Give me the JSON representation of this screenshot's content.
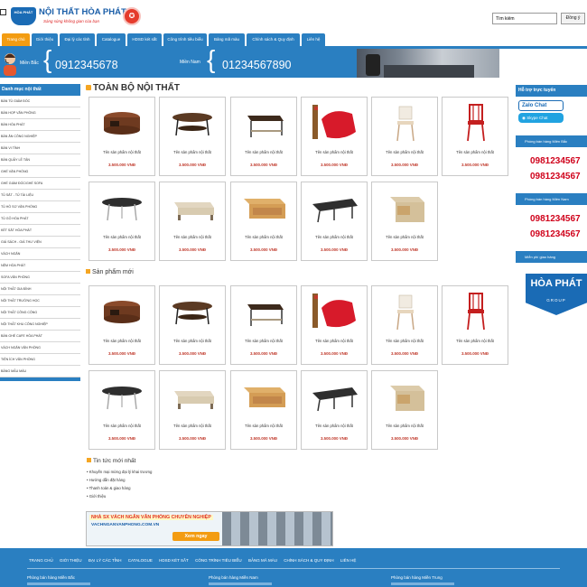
{
  "header": {
    "brand_emblem": "HÒA PHÁT",
    "brand_title": "NỘI THẤT HÒA PHÁT",
    "brand_slogan": "Sáng sủng không gian của bạn",
    "search_placeholder": "Tìm kiếm",
    "search_value": "Tìm kiếm",
    "search_button": "Đồng ý"
  },
  "nav": {
    "items": [
      {
        "label": "Trang chủ",
        "active": true
      },
      {
        "label": "Giới thiệu"
      },
      {
        "label": "Đại lý các tỉnh"
      },
      {
        "label": "Catalogue"
      },
      {
        "label": "HDSD két sắt"
      },
      {
        "label": "Công trình tiêu biểu"
      },
      {
        "label": "Bảng mã màu"
      },
      {
        "label": "Chính sách & Quy định"
      },
      {
        "label": "Liên hệ"
      }
    ]
  },
  "banner": {
    "north_label": "Miền Bắc",
    "north_phone": "0912345678",
    "south_label": "Miền Nam",
    "south_phone": "01234567890"
  },
  "left_sidebar": {
    "title": "Danh mục nội thất",
    "items": [
      "BÀN TỦ GIÁM ĐỐC",
      "BÀN HỌP VĂN PHÒNG",
      "BÀN HÒA PHÁT",
      "BÀN ĂN CÔNG NGHIỆP",
      "BÀN VI TÍNH",
      "BÀN QUẦY LỄ TÂN",
      "GHẾ VĂN PHÒNG",
      "GHẾ GIÁM ĐỐC/GHẾ SOFA",
      "TỦ SẮT - TỦ TÀI LIỆU",
      "TỦ HỒ SƠ VĂN PHÒNG",
      "TỦ GỖ HÒA PHÁT",
      "KÉT SẮT HÒA PHÁT",
      "GIÁ SÁCH - GIÁ THƯ VIỆN",
      "VÁCH NGĂN",
      "NỆM HÒA PHÁT",
      "SOFA VĂN PHÒNG",
      "NỘI THẤT GIA ĐÌNH",
      "NỘI THẤT TRƯỜNG HỌC",
      "NỘI THẤT CÔNG CỘNG",
      "NỘI THẤT KHU CÔNG NGHIỆP",
      "BÀN GHẾ CAFE HÒA PHÁT",
      "VÁCH NGĂN VĂN PHÒNG",
      "TIỆN ÍCH VĂN PHÒNG",
      "BẢNG MẪU MÀU"
    ]
  },
  "main": {
    "section1_title": "TOÀN BỘ NỘI THẤT",
    "section2_title": "Sản phẩm mới",
    "product_name": "Tên sản phẩm nội thất",
    "product_price": "3.500.000 VNĐ"
  },
  "right_sidebar": {
    "support_title": "Hỗ trợ trực tuyến",
    "zalo_label": "Zalo Chat",
    "skype_label": "Skype Chat",
    "north_sales": "Phòng bán hàng Miền Bắc",
    "north_phones": [
      "0981234567",
      "0981234567"
    ],
    "south_sales": "Phòng bán hàng Miền Nam",
    "south_phones": [
      "0981234567",
      "0981234567"
    ],
    "free_shipping": "Miễn phí giao hàng",
    "hp_logo": "HÒA PHÁT",
    "hp_group": "GROUP"
  },
  "news": {
    "title": "Tin tức mới nhất",
    "items": [
      "Khuyến mại mừng đại lý khai trương",
      "Hướng dẫn đặt hàng",
      "Thanh toán & giao hàng",
      "Giới thiệu"
    ]
  },
  "ad": {
    "line1": "NHÀ SX VÁCH NGĂN VĂN PHÒNG CHUYÊN NGHIỆP",
    "line2": "VACHNGANVANPHONG.COM.VN",
    "cta": "Xem ngay"
  },
  "footer": {
    "links": [
      "TRANG CHỦ",
      "GIỚI THIỆU",
      "ĐẠI LÝ CÁC TỈNH",
      "CATALOGUE",
      "HDSD KÉT SẮT",
      "CÔNG TRÌNH TIÊU BIỂU",
      "BẢNG MÃ MÀU",
      "CHÍNH SÁCH & QUY ĐỊNH",
      "LIÊN HỆ"
    ],
    "col1": "Phòng bán hàng Miền Bắc",
    "col2": "Phòng bán hàng Miền Nam",
    "col3": "Phòng bán hàng Miền Trung"
  },
  "colors": {
    "primary": "#2a7fc1",
    "accent": "#f39c12",
    "price": "#c0392b",
    "phone_red": "#d0021b"
  },
  "product_images": [
    "round-wood-table",
    "round-coffee-table",
    "dark-side-table",
    "red-armchair",
    "white-wooden-chair",
    "red-wooden-chair",
    "oval-black-table",
    "light-coffee-table",
    "wooden-coffee-table",
    "triangle-black-table",
    "light-cube-table"
  ]
}
